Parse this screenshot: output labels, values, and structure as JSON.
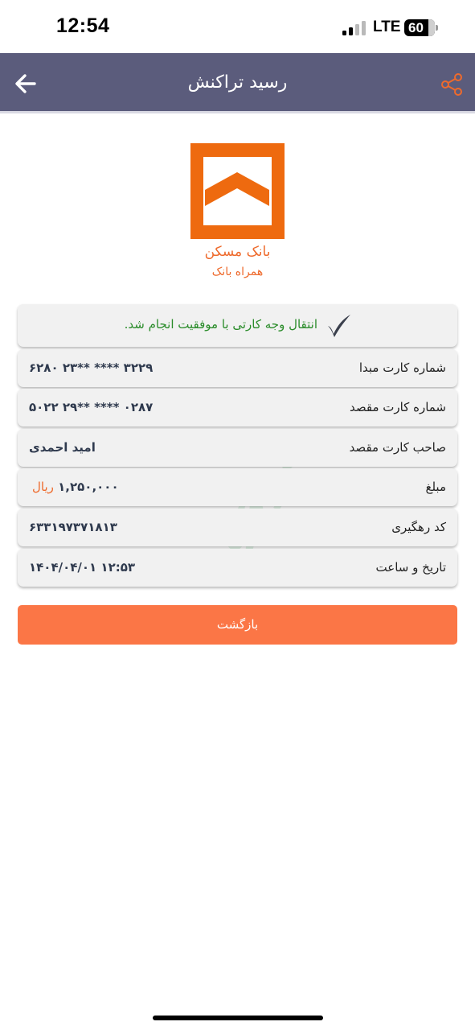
{
  "status_bar": {
    "time": "12:54",
    "network": "LTE",
    "battery": "60"
  },
  "header": {
    "title": "رسید تراکنش",
    "back_icon": "arrow-left-icon",
    "share_icon": "share-icon",
    "color": "#5b5c7c"
  },
  "bank": {
    "name": "بانک مسکن",
    "app": "همراه بانک",
    "logo_color": "#ee6a0f"
  },
  "receipt": {
    "success_message": "انتقال وجه کارتی با موفقیت انجام شد.",
    "rows": [
      {
        "label": "شماره کارت مبدا",
        "value": "۶۲۸۰ ۲۳** **** ۳۲۲۹"
      },
      {
        "label": "شماره کارت مقصد",
        "value": "۵۰۲۲ ۲۹** **** ۰۲۸۷"
      },
      {
        "label": "صاحب کارت مقصد",
        "value": "امید احمدی"
      },
      {
        "label": "مبلغ",
        "value": "۱,۲۵۰,۰۰۰",
        "currency": "ریال"
      },
      {
        "label": "کد رهگیری",
        "value": "۶۳۳۱۹۷۳۷۱۸۱۳"
      },
      {
        "label": "تاریخ و ساعت",
        "value": "۱۴۰۴/۰۴/۰۱ ۱۲:۵۳"
      }
    ]
  },
  "watermark": "موفق",
  "actions": {
    "return_label": "بازگشت",
    "accent_color": "#fb7646"
  }
}
